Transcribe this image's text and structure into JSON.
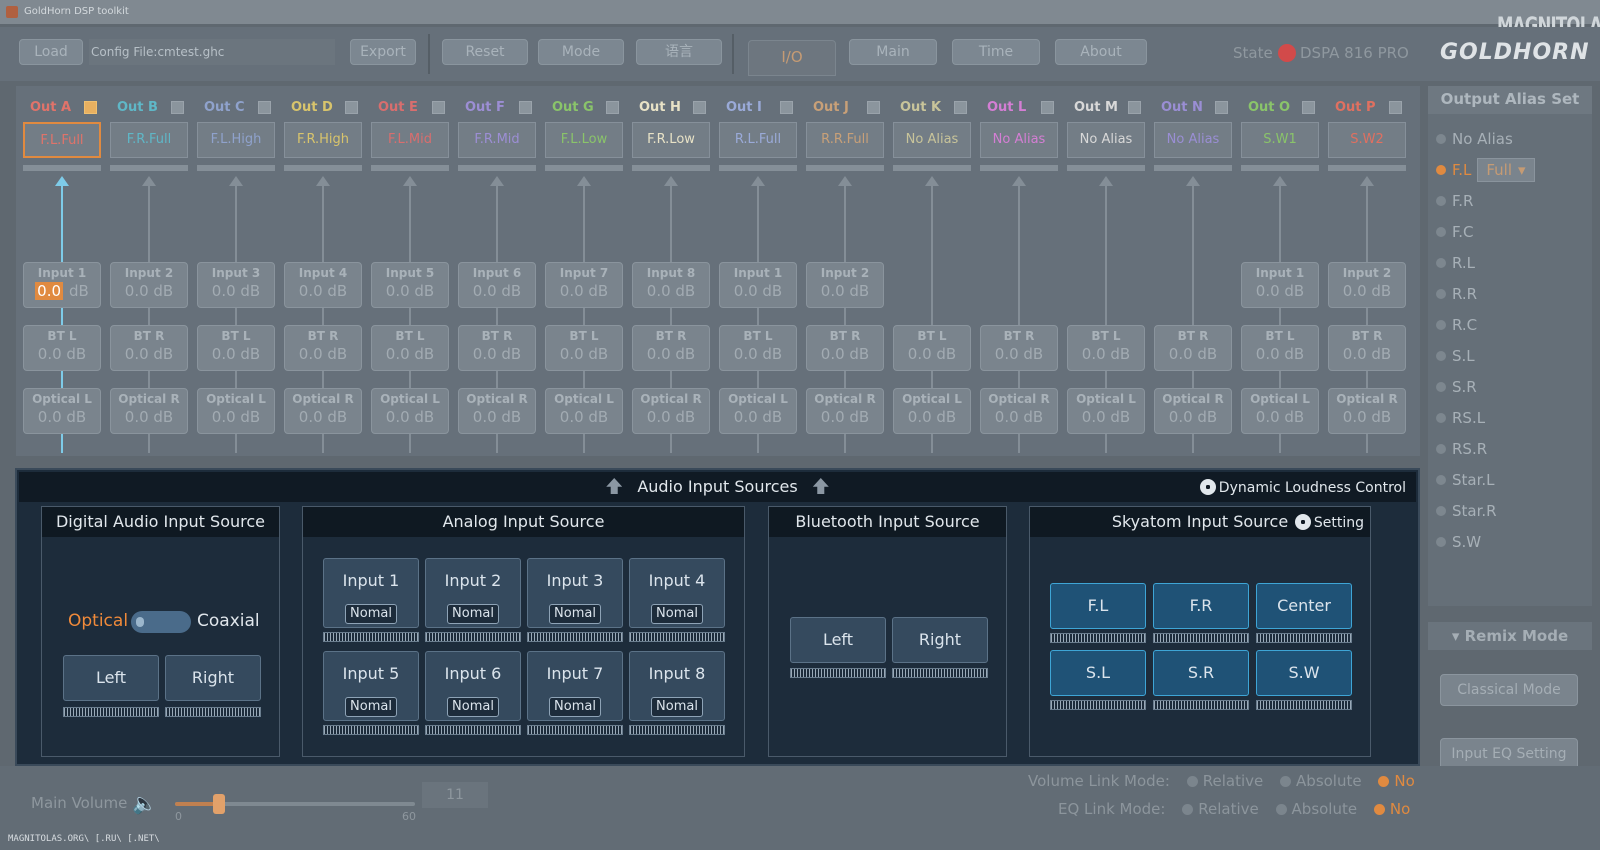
{
  "window": {
    "title": "GoldHorn DSP toolkit"
  },
  "watermark": "MAGNITOLA",
  "toolbar": {
    "load": "Load",
    "config_file": "Config File:cmtest.ghc",
    "export": "Export",
    "reset": "Reset",
    "mode": "Mode",
    "lang": "语言",
    "tabs": [
      "I/O",
      "Main",
      "Time",
      "About"
    ],
    "state_label": "State",
    "device": "DSPA 816 PRO",
    "brand": "GOLDHORN"
  },
  "outputs": [
    {
      "name": "Out A",
      "alias": "F.L.Full",
      "color": "#e0736a"
    },
    {
      "name": "Out B",
      "alias": "F.R.Full",
      "color": "#5fb7c7"
    },
    {
      "name": "Out C",
      "alias": "F.L.High",
      "color": "#8fa2cc"
    },
    {
      "name": "Out D",
      "alias": "F.R.High",
      "color": "#d8c46c"
    },
    {
      "name": "Out E",
      "alias": "F.L.Mid",
      "color": "#d86e6e"
    },
    {
      "name": "Out F",
      "alias": "F.R.Mid",
      "color": "#9c8ed4"
    },
    {
      "name": "Out G",
      "alias": "F.L.Low",
      "color": "#8ac46a"
    },
    {
      "name": "Out H",
      "alias": "F.R.Low",
      "color": "#e8e2c6"
    },
    {
      "name": "Out I",
      "alias": "R.L.Full",
      "color": "#9aaad8"
    },
    {
      "name": "Out J",
      "alias": "R.R.Full",
      "color": "#c8a078"
    },
    {
      "name": "Out K",
      "alias": "No Alias",
      "color": "#c8c49a"
    },
    {
      "name": "Out L",
      "alias": "No Alias",
      "color": "#d47ed4"
    },
    {
      "name": "Out M",
      "alias": "No Alias",
      "color": "#d8d8d8"
    },
    {
      "name": "Out N",
      "alias": "No Alias",
      "color": "#9a8ed4"
    },
    {
      "name": "Out O",
      "alias": "S.W1",
      "color": "#8ac46a"
    },
    {
      "name": "Out P",
      "alias": "S.W2",
      "color": "#e07060"
    }
  ],
  "row_inputs": [
    "Input 1",
    "Input 2",
    "Input 3",
    "Input 4",
    "Input 5",
    "Input 6",
    "Input 7",
    "Input 8",
    "Input 1",
    "Input 2",
    "",
    "",
    "",
    "",
    "Input 1",
    "Input 2"
  ],
  "row_bt": [
    "BT L",
    "BT R",
    "BT L",
    "BT R",
    "BT L",
    "BT R",
    "BT L",
    "BT R",
    "BT L",
    "BT R",
    "BT L",
    "BT R",
    "BT L",
    "BT R",
    "BT L",
    "BT R"
  ],
  "row_optical": [
    "Optical L",
    "Optical R",
    "Optical L",
    "Optical R",
    "Optical L",
    "Optical R",
    "Optical L",
    "Optical R",
    "Optical L",
    "Optical R",
    "Optical L",
    "Optical R",
    "Optical L",
    "Optical R",
    "Optical L",
    "Optical R"
  ],
  "db": "0.0 dB",
  "db_first_value": "0.0",
  "db_unit": "dB",
  "alias_panel": {
    "title": "Output Alias Set",
    "items": [
      "No Alias",
      "F.L",
      "F.R",
      "F.C",
      "R.L",
      "R.R",
      "R.C",
      "S.L",
      "S.R",
      "RS.L",
      "RS.R",
      "Star.L",
      "Star.R",
      "S.W"
    ],
    "selected": "F.L",
    "dropdown": "Full"
  },
  "remix": {
    "title": "Remix Mode",
    "mode": "Classical Mode",
    "eq": "Input EQ Setting"
  },
  "audio_panel": {
    "title": "Audio Input Sources",
    "dlc": "Dynamic Loudness Control",
    "digital": {
      "title": "Digital Audio Input Source",
      "optical": "Optical",
      "coaxial": "Coaxial",
      "left": "Left",
      "right": "Right"
    },
    "analog": {
      "title": "Analog Input Source",
      "inputs": [
        "Input 1",
        "Input 2",
        "Input 3",
        "Input 4",
        "Input 5",
        "Input 6",
        "Input 7",
        "Input 8"
      ],
      "mode": "Nomal"
    },
    "bluetooth": {
      "title": "Bluetooth Input Source",
      "left": "Left",
      "right": "Right"
    },
    "skyatom": {
      "title": "Skyatom Input Source",
      "setting": "Setting",
      "channels": [
        "F.L",
        "F.R",
        "Center",
        "S.L",
        "S.R",
        "S.W"
      ]
    }
  },
  "bottom": {
    "main_volume": "Main Volume",
    "vol_min": "0",
    "vol_max": "60",
    "vol_value": "11",
    "vol_fraction": 0.183,
    "volume_link": "Volume Link Mode:",
    "eq_link": "EQ Link Mode:",
    "opts": [
      "Relative",
      "Absolute",
      "No"
    ]
  },
  "footer": "MAGNITOLAS.ORG\\ [.RU\\ [.NET\\"
}
